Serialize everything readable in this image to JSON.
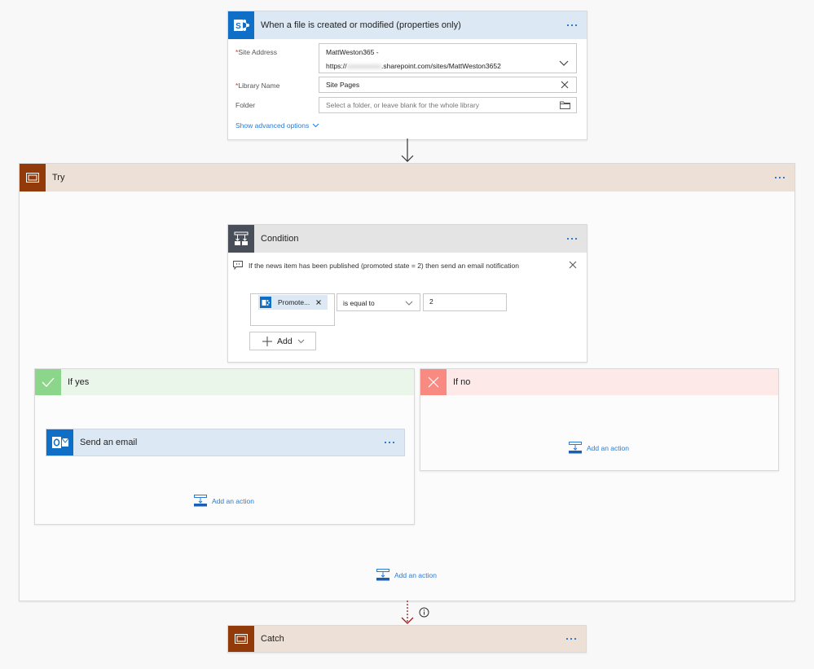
{
  "trigger": {
    "title": "When a file is created or modified (properties only)",
    "icon": "sharepoint-icon",
    "fields": {
      "site_address": {
        "label": "Site Address",
        "required": "*",
        "value_line1": "MattWeston365 -",
        "value_line2_prefix": "https://",
        "value_line2_blurred": "xxxxxxxxxx",
        "value_line2_suffix": ".sharepoint.com/sites/MattWeston3652"
      },
      "library_name": {
        "label": "Library Name",
        "required": "*",
        "value": "Site Pages"
      },
      "folder": {
        "label": "Folder",
        "placeholder": "Select a folder, or leave blank for the whole library"
      }
    },
    "advanced_link": "Show advanced options"
  },
  "try_scope": {
    "title": "Try",
    "icon": "scope-icon",
    "color": "#933a0a",
    "header_bg": "#ede0d7"
  },
  "condition": {
    "title": "Condition",
    "icon": "condition-icon",
    "comment": "If the news item has been published (promoted state = 2) then send an email notification",
    "token_label": "Promote...",
    "operator": "is equal to",
    "value": "2",
    "add_label": "Add"
  },
  "if_yes": {
    "title": "If yes",
    "color": "#8cd68c",
    "header_bg": "#ebf6eb",
    "action": {
      "title": "Send an email",
      "icon": "outlook-icon"
    },
    "add_action": "Add an action"
  },
  "if_no": {
    "title": "If no",
    "color": "#f88a82",
    "header_bg": "#fde9e8",
    "add_action": "Add an action"
  },
  "try_add_action": "Add an action",
  "catch_scope": {
    "title": "Catch",
    "icon": "scope-icon",
    "color": "#933a0a",
    "header_bg": "#ede0d7"
  }
}
